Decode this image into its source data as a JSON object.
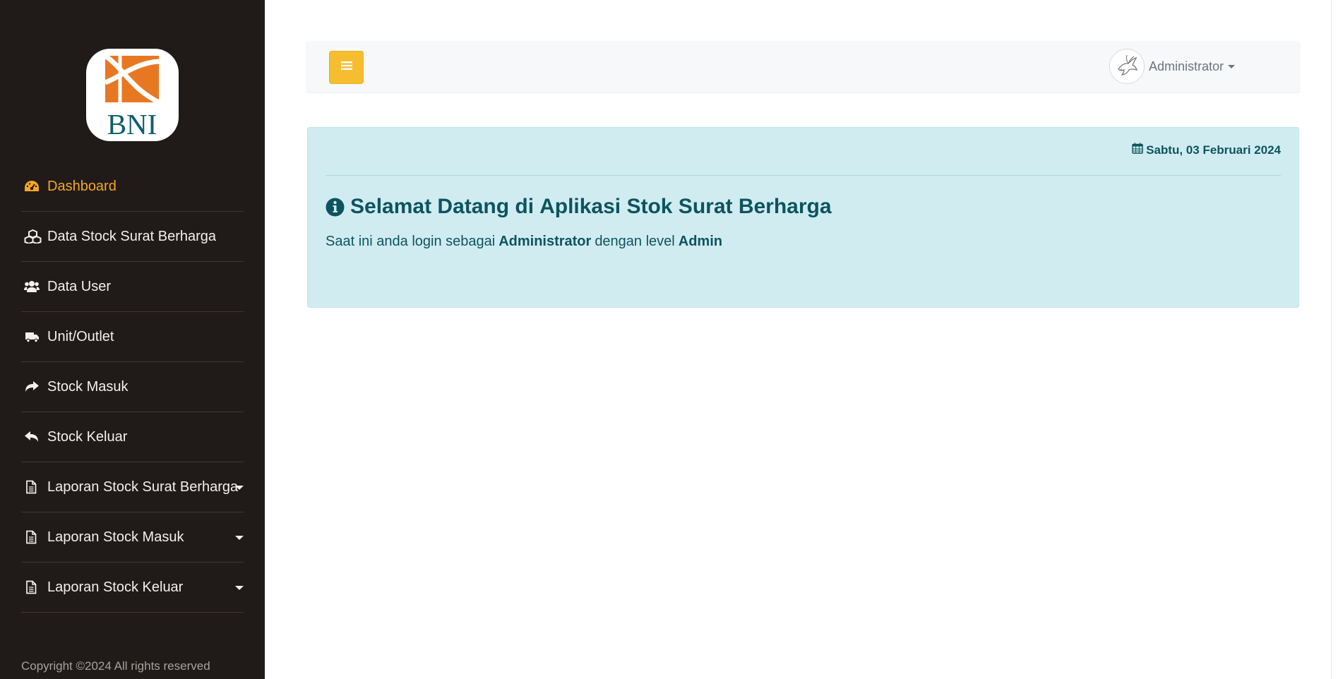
{
  "brand": {
    "logo_text": "BNI"
  },
  "sidebar": {
    "items": [
      {
        "label": "Dashboard",
        "icon": "dashboard-gauge-icon",
        "active": true
      },
      {
        "label": "Data Stock Surat Berharga",
        "icon": "cubes-icon"
      },
      {
        "label": "Data User",
        "icon": "users-icon"
      },
      {
        "label": "Unit/Outlet",
        "icon": "truck-icon"
      },
      {
        "label": "Stock Masuk",
        "icon": "share-arrow-icon"
      },
      {
        "label": "Stock Keluar",
        "icon": "reply-arrow-icon"
      },
      {
        "label": "Laporan Stock Surat Berharga",
        "icon": "file-text-icon",
        "dropdown": true
      },
      {
        "label": "Laporan Stock Masuk",
        "icon": "file-text-icon",
        "dropdown": true
      },
      {
        "label": "Laporan Stock Keluar",
        "icon": "file-text-icon",
        "dropdown": true
      }
    ],
    "copyright": "Copyright ©2024 All rights reserved"
  },
  "topbar": {
    "toggle_icon": "bars-icon",
    "user_name": "Administrator"
  },
  "welcome": {
    "date": "Sabtu, 03 Februari 2024",
    "title_prefix": "Selamat Datang di",
    "title_app": "Aplikasi Stok Surat Berharga",
    "login_prefix": "Saat ini anda login sebagai",
    "login_user": "Administrator",
    "login_middle": "dengan level",
    "login_level": "Admin"
  },
  "colors": {
    "sidebar_bg": "#201b19",
    "active": "#f5a623",
    "toggle_button": "#f6bd2e",
    "alert_bg": "#d1ecf1",
    "alert_text": "#0c5460",
    "logo_orange": "#e87722",
    "logo_teal": "#0e5e6f"
  }
}
